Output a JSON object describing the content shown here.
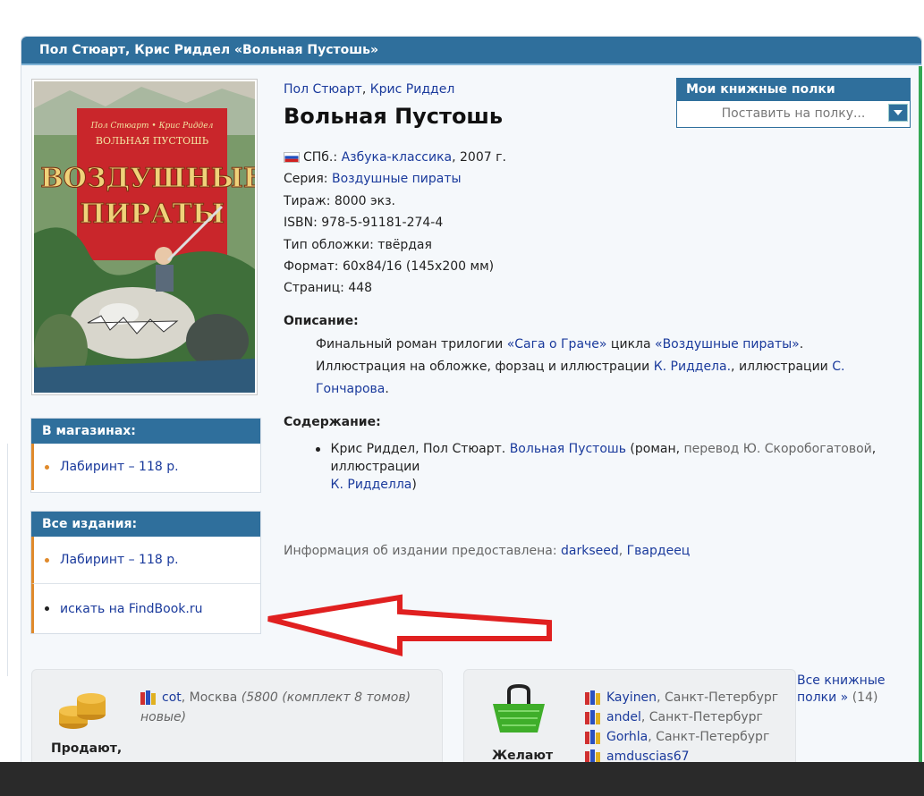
{
  "page_header": {
    "title": "Пол Стюарт, Крис Риддел «Вольная Пустошь»"
  },
  "book": {
    "author1": "Пол Стюарт",
    "author_sep": ", ",
    "author2": "Крис Риддел",
    "title": "Вольная Пустошь",
    "publisher_city": "СПб.:",
    "publisher": "Азбука-классика",
    "year": ", 2007 г.",
    "series_label": "Серия:",
    "series": "Воздушные пираты",
    "print_run": "Тираж: 8000 экз.",
    "isbn": "ISBN: 978-5-91181-274-4",
    "cover_type": "Тип обложки: твёрдая",
    "format": "Формат: 60x84/16 (145x200 мм)",
    "pages": "Страниц: 448"
  },
  "cover": {
    "authors": "Пол Стюарт • Крис Риддел",
    "small_title": "ВОЛЬНАЯ ПУСТОШЬ",
    "big_title_1": "ВОЗДУШНЫЕ",
    "big_title_2": "ПИРАТЫ"
  },
  "description": {
    "heading": "Описание:",
    "line1_prefix": "Финальный роман трилогии ",
    "line1_link1": "«Сага о Граче»",
    "line1_mid": " цикла ",
    "line1_link2": "«Воздушные пираты»",
    "line1_end": ".",
    "line2_prefix": "Иллюстрация на обложке, форзац и иллюстрации ",
    "line2_link1": "К. Риддела.",
    "line2_mid": ", иллюстрации ",
    "line2_link2": "С. Гончарова",
    "line2_end": "."
  },
  "contents": {
    "heading": "Содержание:",
    "item_prefix": "Крис Риддел, Пол Стюарт. ",
    "item_link": "Вольная Пустошь",
    "item_mid": " (роман, ",
    "item_translation": "перевод Ю. Скоробогатовой",
    "item_mid2": ", иллюстрации ",
    "item_illustrator": "К. Ридделла",
    "item_end": ")"
  },
  "provided": {
    "label": "Информация об издании предоставлена: ",
    "user1": "darkseed",
    "sep": ", ",
    "user2": "Гвардеец"
  },
  "shelves": {
    "heading": "Мои книжные полки",
    "placeholder": "Поставить на полку..."
  },
  "in_shops": {
    "heading": "В магазинах:",
    "items": [
      "Лабиринт – 118 р."
    ]
  },
  "all_editions": {
    "heading": "Все издания:",
    "items": [
      "Лабиринт – 118 р.",
      "искать на FindBook.ru"
    ]
  },
  "sell_panel": {
    "label": "Продают,",
    "user": "cot",
    "city": ", Москва ",
    "note1": "(5800 (комплект 8 томов)",
    "note2": "новые)"
  },
  "want_panel": {
    "label": "Желают",
    "users": [
      {
        "name": "Kayinen",
        "city": ", Санкт-Петербург"
      },
      {
        "name": "andel",
        "city": ", Санкт-Петербург"
      },
      {
        "name": "Gorhla",
        "city": ", Санкт-Петербург"
      },
      {
        "name": "amduscias67",
        "city": ""
      }
    ]
  },
  "all_shelves": {
    "link1": "Все книжные",
    "link2": "полки »",
    "count": " (14)"
  },
  "colors": {
    "header_blue": "#2f6f9c",
    "link": "#1a3a9c",
    "accent_orange": "#e08a2b",
    "arrow_red": "#e02020"
  }
}
